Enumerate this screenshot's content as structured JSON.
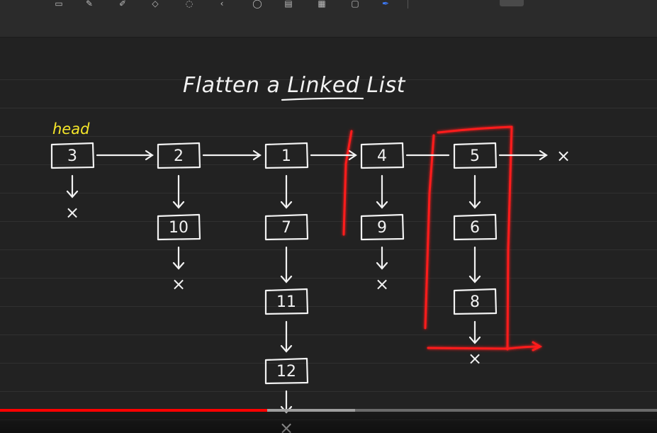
{
  "toolbar": {
    "tool_icons": [
      "select-icon",
      "pen-icon",
      "highlighter-icon",
      "eraser-icon",
      "lasso-icon",
      "back-arrow-icon",
      "shape-icon",
      "text-icon",
      "image-icon",
      "sticky-note-icon",
      "blue-pen-icon"
    ]
  },
  "board": {
    "title": "Flatten a Linked List",
    "head_label": "head",
    "null_symbol": "×",
    "arrow_glyph": "⟶",
    "down_glyph": "↓"
  },
  "columns": [
    {
      "top": "3",
      "children": []
    },
    {
      "top": "2",
      "children": [
        "10"
      ]
    },
    {
      "top": "1",
      "children": [
        "7",
        "11",
        "12"
      ]
    },
    {
      "top": "4",
      "children": [
        "9"
      ]
    },
    {
      "top": "5",
      "children": [
        "6",
        "8"
      ]
    }
  ],
  "colors": {
    "ink": "#f2f2f2",
    "head_label": "#f5e62a",
    "highlight": "#ff1a1a",
    "progress_played": "#ff0000"
  },
  "player": {
    "progress_fraction": 0.407,
    "buffer_fraction": 0.54
  }
}
